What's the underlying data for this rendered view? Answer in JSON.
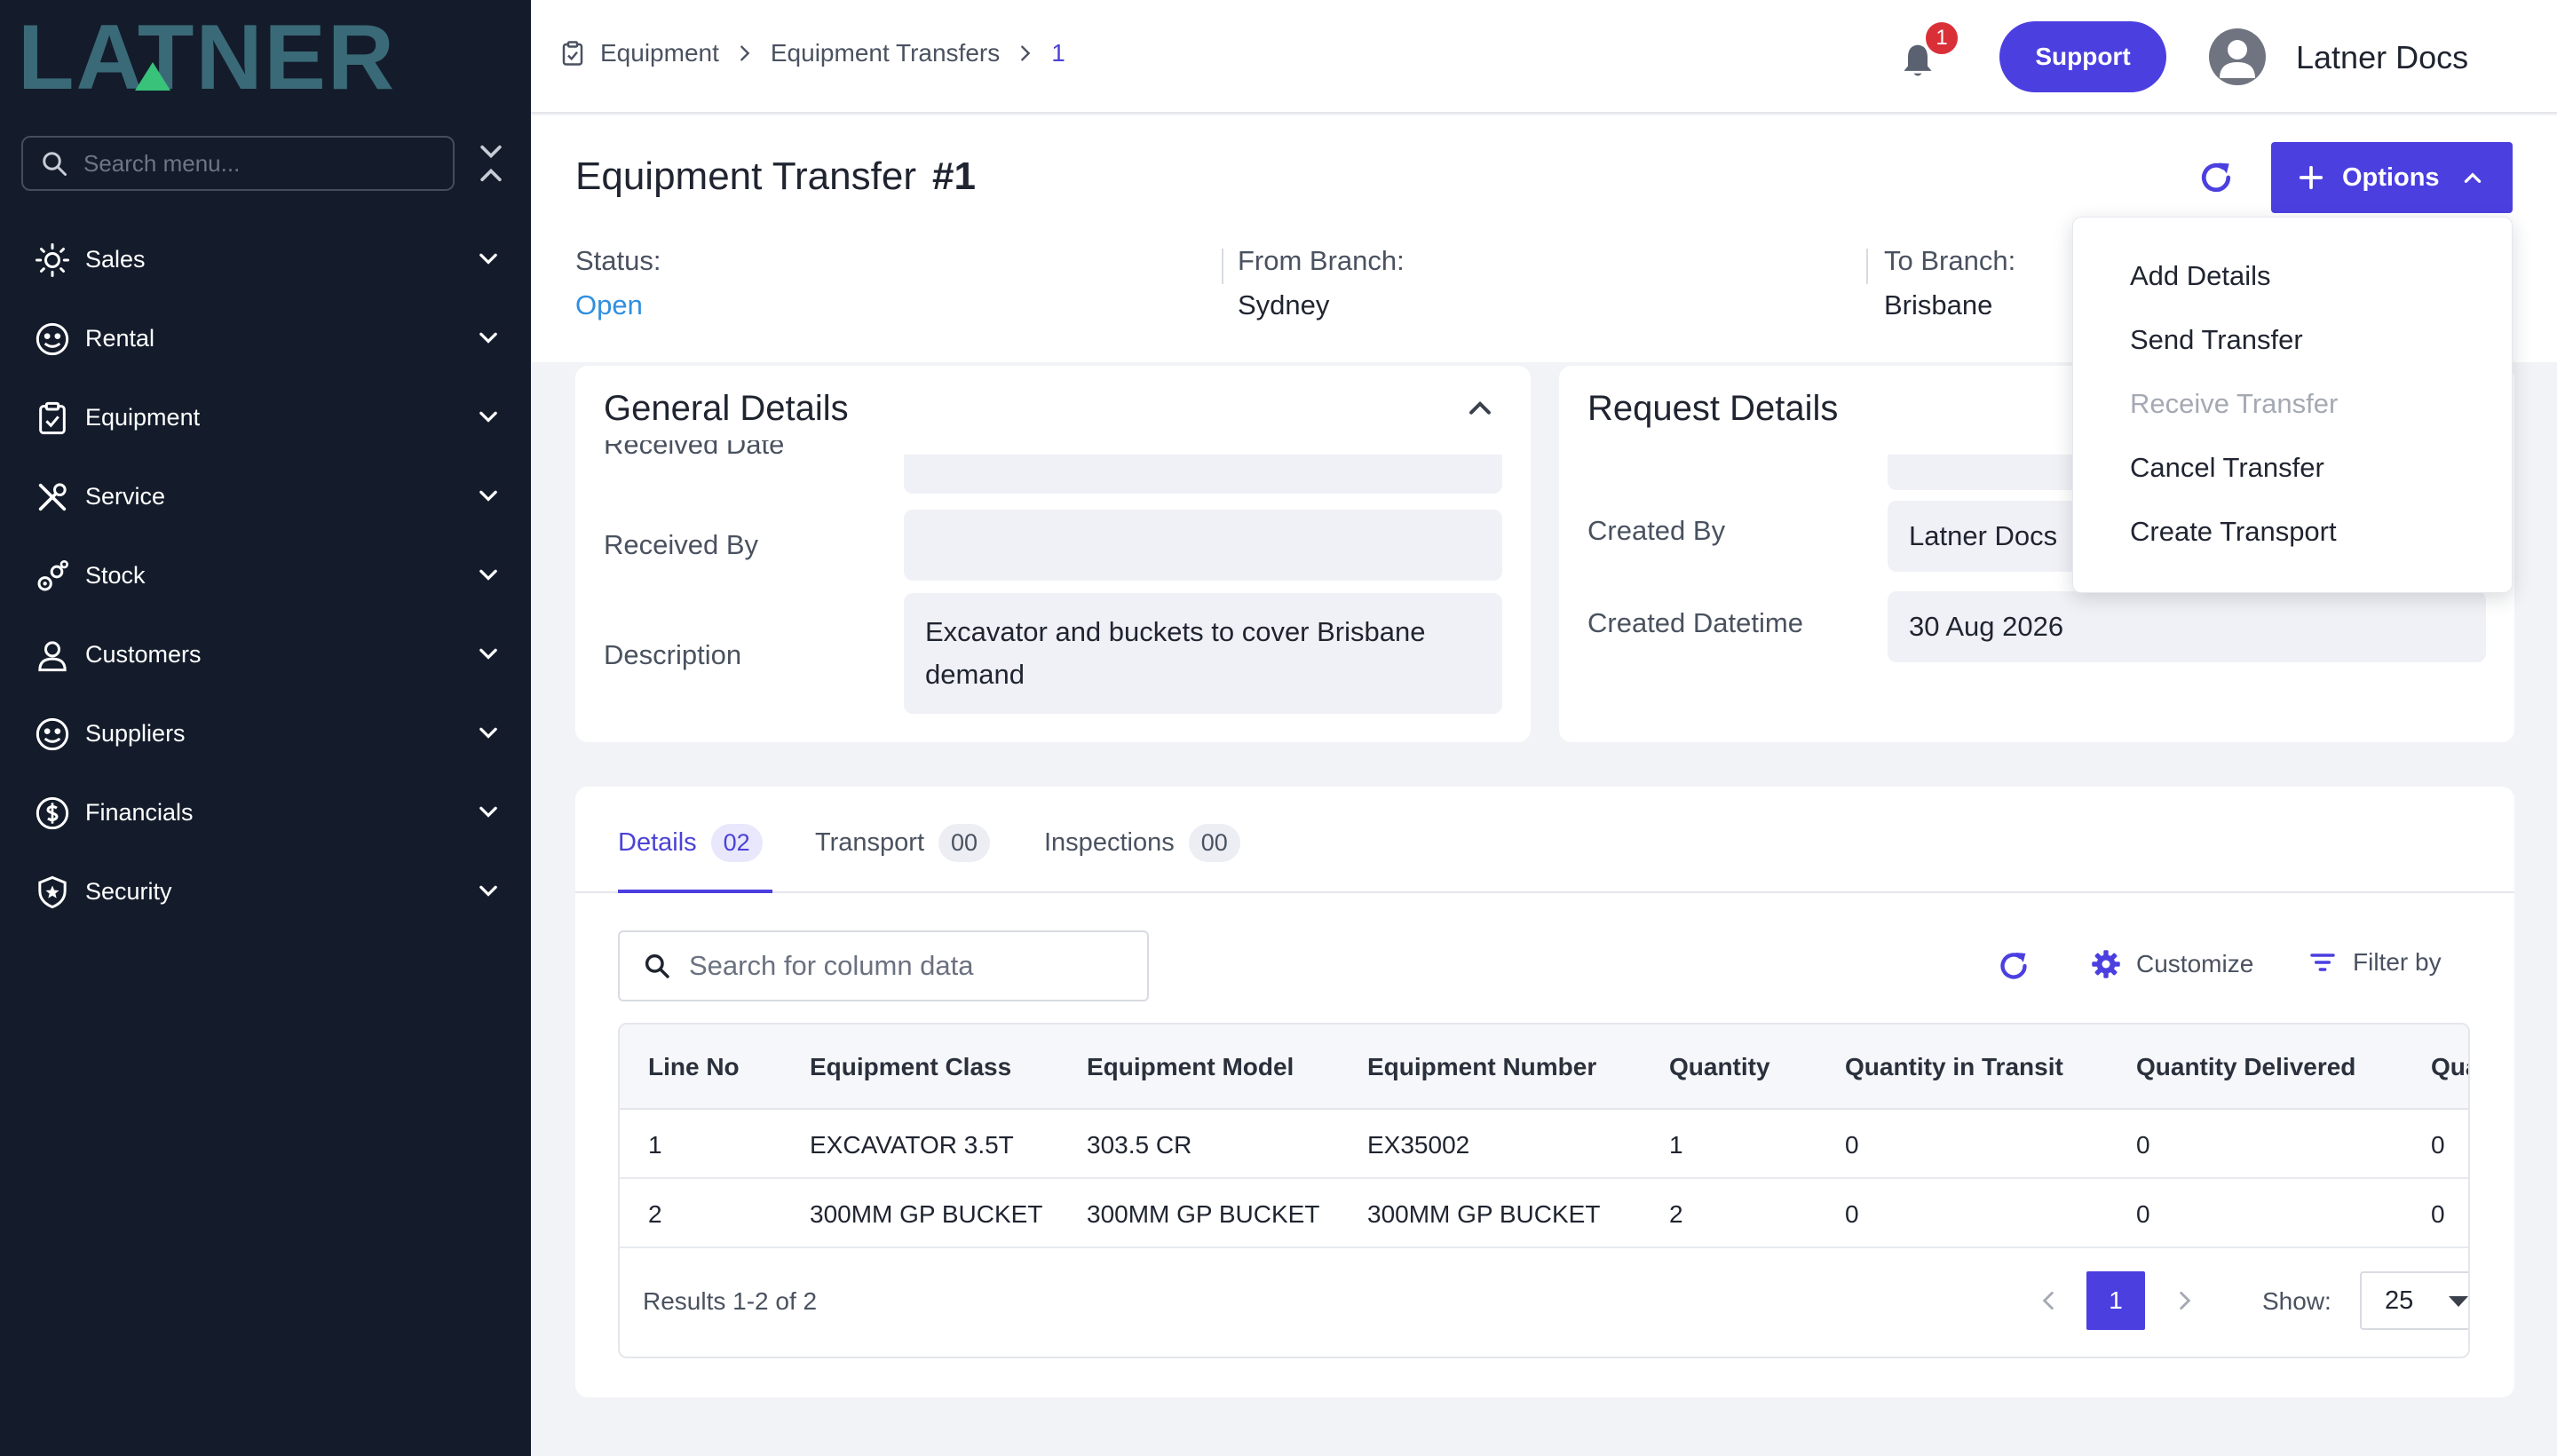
{
  "brand": {
    "logo_text": "LATNER"
  },
  "sidebar": {
    "search_placeholder": "Search menu...",
    "items": [
      {
        "label": "Sales",
        "icon": "sales-icon"
      },
      {
        "label": "Rental",
        "icon": "rental-icon"
      },
      {
        "label": "Equipment",
        "icon": "equipment-icon"
      },
      {
        "label": "Service",
        "icon": "service-icon"
      },
      {
        "label": "Stock",
        "icon": "stock-icon"
      },
      {
        "label": "Customers",
        "icon": "customers-icon"
      },
      {
        "label": "Suppliers",
        "icon": "suppliers-icon"
      },
      {
        "label": "Financials",
        "icon": "financials-icon"
      },
      {
        "label": "Security",
        "icon": "security-icon"
      }
    ]
  },
  "topbar": {
    "breadcrumb": [
      "Equipment",
      "Equipment Transfers",
      "1"
    ],
    "notification_count": "1",
    "support_label": "Support",
    "user_name": "Latner Docs"
  },
  "header": {
    "title": "Equipment Transfer",
    "number": "#1",
    "options_label": "Options",
    "status_label": "Status:",
    "status_value": "Open",
    "from_label": "From Branch:",
    "from_value": "Sydney",
    "to_label": "To Branch:",
    "to_value": "Brisbane"
  },
  "options_menu": {
    "items": [
      {
        "label": "Add Details",
        "disabled": false
      },
      {
        "label": "Send Transfer",
        "disabled": false
      },
      {
        "label": "Receive Transfer",
        "disabled": true
      },
      {
        "label": "Cancel Transfer",
        "disabled": false
      },
      {
        "label": "Create Transport",
        "disabled": false
      }
    ]
  },
  "general_details": {
    "title": "General Details",
    "received_date_label": "Received Date",
    "received_date_value": "",
    "received_by_label": "Received By",
    "received_by_value": "",
    "description_label": "Description",
    "description_value": "Excavator and buckets to cover Brisbane demand"
  },
  "request_details": {
    "title": "Request Details",
    "created_by_label": "Created By",
    "created_by_value": "Latner Docs",
    "created_datetime_label": "Created Datetime",
    "created_datetime_value": "30 Aug 2026"
  },
  "tabs": [
    {
      "label": "Details",
      "count": "02",
      "active": true
    },
    {
      "label": "Transport",
      "count": "00",
      "active": false
    },
    {
      "label": "Inspections",
      "count": "00",
      "active": false
    }
  ],
  "table": {
    "search_placeholder": "Search for column data",
    "customize_label": "Customize",
    "filter_label": "Filter by",
    "columns": [
      "Line No",
      "Equipment Class",
      "Equipment Model",
      "Equipment Number",
      "Quantity",
      "Quantity in Transit",
      "Quantity Delivered",
      "Quantity Received"
    ],
    "rows": [
      [
        "1",
        "EXCAVATOR 3.5T",
        "303.5 CR",
        "EX35002",
        "1",
        "0",
        "0",
        "0"
      ],
      [
        "2",
        "300MM GP BUCKET",
        "300MM GP BUCKET",
        "300MM GP BUCKET",
        "2",
        "0",
        "0",
        "0"
      ]
    ],
    "results_text": "Results 1-2 of 2",
    "current_page": "1",
    "show_label": "Show:",
    "page_size": "25"
  },
  "colors": {
    "sidebar_bg": "#141c2b",
    "accent": "#4b3fe0",
    "logo_teal": "#3a6a78",
    "logo_green": "#39c27a",
    "status_open": "#2f8fe0"
  }
}
